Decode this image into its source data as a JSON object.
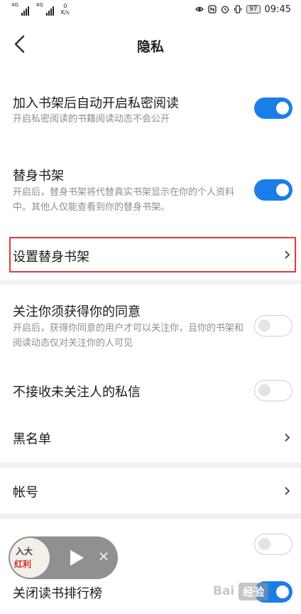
{
  "status_bar": {
    "sim1_tag": "4G",
    "sim2_tag": "4G",
    "speed_value": "0",
    "speed_unit": "K/s",
    "battery": "97",
    "time": "09:45",
    "icons": [
      "eye-icon",
      "nfc-icon",
      "alarm-icon",
      "vibrate-icon"
    ]
  },
  "header": {
    "title": "隐私",
    "back_icon": "chevron-left-icon"
  },
  "settings": {
    "auto_private": {
      "title": "加入书架后自动开启私密阅读",
      "desc": "开启私密阅读的书籍阅读动态不会公开",
      "enabled": true
    },
    "proxy_shelf": {
      "title": "替身书架",
      "desc": "开启后，替身书架将代替真实书架显示在你的个人资料中。其他人仅能查看到你的替身书架。",
      "enabled": true
    },
    "set_proxy_shelf": {
      "title": "设置替身书架"
    },
    "follow_consent": {
      "title": "关注你须获得你的同意",
      "desc": "开启后，获得你同意的用户才可以关注你，且你的书架和阅读动态仅对关注你的人可见",
      "enabled": false
    },
    "reject_messages": {
      "title": "不接收未关注人的私信",
      "enabled": false
    },
    "blacklist": {
      "title": "黑名单"
    },
    "account": {
      "title": "帐号"
    },
    "partial_row": {
      "enabled": false
    },
    "disable_ranking": {
      "title": "关闭读书排行榜",
      "enabled": true
    }
  },
  "floating_player": {
    "cover_text_1": "入大",
    "cover_text_2": "红利",
    "play_icon": "play-icon",
    "close_icon": "close-icon"
  },
  "watermark": {
    "text": "Bai",
    "badge": "经验"
  },
  "colors": {
    "accent": "#1a7ee8",
    "highlight": "#e5393a",
    "divider": "#f1f1f1",
    "secondary_text": "#8e8e8e"
  }
}
